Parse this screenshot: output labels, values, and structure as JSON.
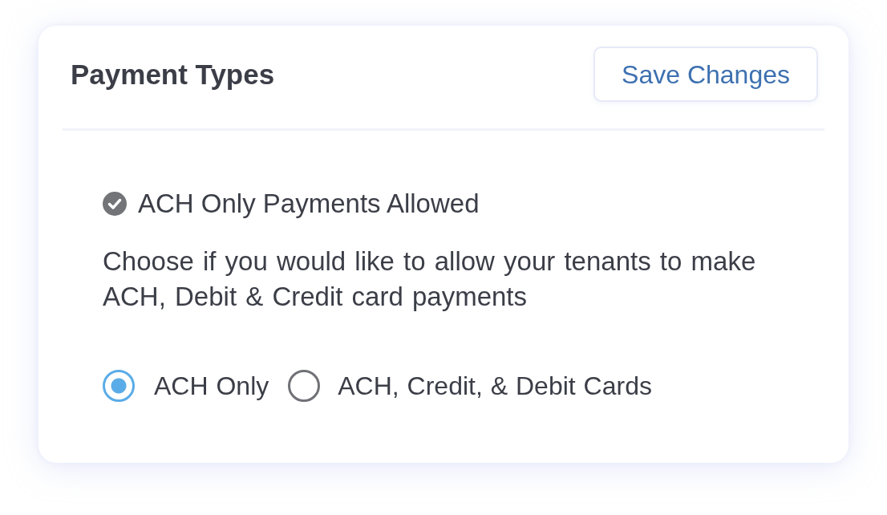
{
  "header": {
    "title": "Payment Types",
    "save_button": "Save Changes"
  },
  "status": {
    "checked": true,
    "label": "ACH Only Payments Allowed"
  },
  "description": "Choose if you would like to allow your tenants to make ACH, Debit & Credit card payments",
  "payment_options": [
    {
      "label": "ACH Only",
      "selected": true
    },
    {
      "label": "ACH, Credit, & Debit Cards",
      "selected": false
    }
  ]
}
